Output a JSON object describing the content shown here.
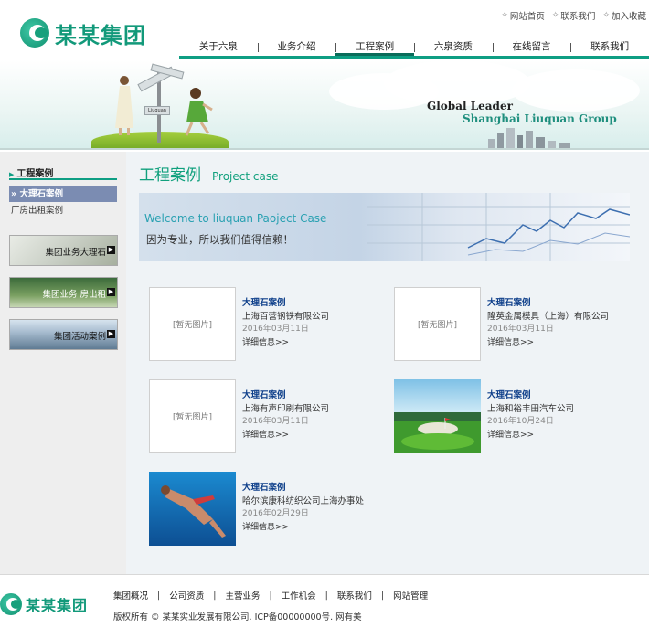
{
  "header": {
    "logo_text": "某某集团",
    "toplinks": [
      {
        "label": "网站首页"
      },
      {
        "label": "联系我们"
      },
      {
        "label": "加入收藏"
      }
    ],
    "nav": [
      {
        "label": "关于六泉"
      },
      {
        "label": "业务介绍"
      },
      {
        "label": "工程案例"
      },
      {
        "label": "六泉资质"
      },
      {
        "label": "在线留言"
      },
      {
        "label": "联系我们"
      }
    ],
    "active_nav": "工程案例"
  },
  "banner": {
    "line1": "Global Leader",
    "line2": "Shanghai Liuquan Group",
    "sign_text": "Liuquan"
  },
  "sidebar": {
    "title": "工程案例",
    "items": [
      {
        "label": "大理石案例",
        "active": true
      },
      {
        "label": "厂房出租案例",
        "active": false
      }
    ],
    "boxes": [
      {
        "label": "集团业务大理石"
      },
      {
        "label": "集团业务 房出租"
      },
      {
        "label": "集团活动案例"
      }
    ]
  },
  "main": {
    "title_cn": "工程案例",
    "title_en": "Project case",
    "banner_en": "Welcome to liuquan Paoject Case",
    "banner_cn": "因为专业，所以我们值得信赖！",
    "no_image_label": "[暂无图片]",
    "detail_label": "详细信息>>",
    "cases": [
      {
        "title": "大理石案例",
        "company": "上海百营钢铁有限公司",
        "date": "2016年03月11日",
        "image": "none"
      },
      {
        "title": "大理石案例",
        "company": "隆英金属模具（上海）有限公司",
        "date": "2016年03月11日",
        "image": "none"
      },
      {
        "title": "大理石案例",
        "company": "上海有声印刷有限公司",
        "date": "2016年03月11日",
        "image": "none"
      },
      {
        "title": "大理石案例",
        "company": "上海和裕丰田汽车公司",
        "date": "2016年10月24日",
        "image": "golf"
      },
      {
        "title": "大理石案例",
        "company": "哈尔滨康科纺织公司上海办事处",
        "date": "2016年02月29日",
        "image": "diver"
      }
    ]
  },
  "footer": {
    "logo_text": "某某集团",
    "links": [
      {
        "label": "集团概况"
      },
      {
        "label": "公司资质"
      },
      {
        "label": "主营业务"
      },
      {
        "label": "工作机会"
      },
      {
        "label": "联系我们"
      },
      {
        "label": "网站管理"
      }
    ],
    "copyright": "版权所有 © 某某实业发展有限公司. ICP备00000000号. 网有美"
  },
  "colors": {
    "brand_green": "#12997a",
    "nav_underline": "#0e9e83",
    "case_title": "#0e3f8a",
    "sidebar_active": "#7b8cb2"
  }
}
